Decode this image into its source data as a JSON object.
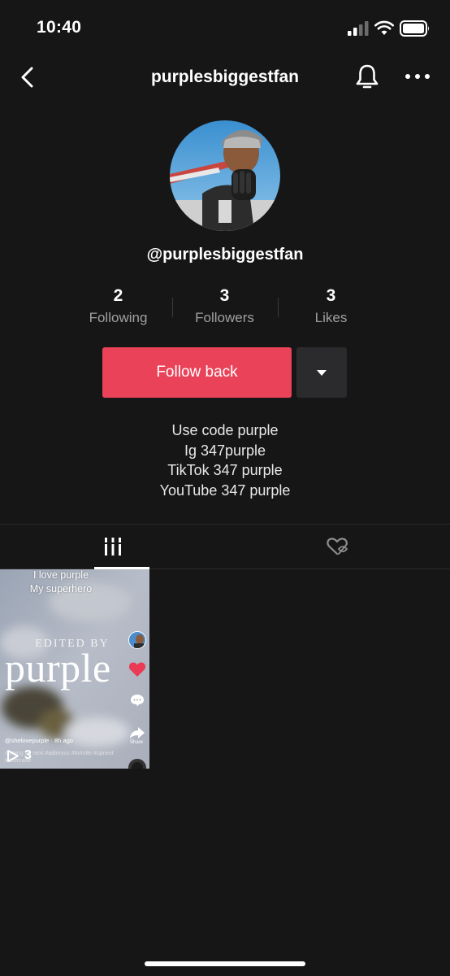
{
  "status_bar": {
    "time": "10:40"
  },
  "nav": {
    "title": "purplesbiggestfan"
  },
  "profile": {
    "handle": "@purplesbiggestfan",
    "stats": [
      {
        "value": "2",
        "label": "Following"
      },
      {
        "value": "3",
        "label": "Followers"
      },
      {
        "value": "3",
        "label": "Likes"
      }
    ],
    "follow_label": "Follow back",
    "bio": [
      "Use code purple",
      "Ig 347purple",
      "TikTok 347 purple",
      "YouTube 347 purple"
    ]
  },
  "tabs": [
    {
      "icon": "grid-icon",
      "active": true
    },
    {
      "icon": "liked-private-icon",
      "active": false
    }
  ],
  "videos": [
    {
      "caption_line1": "I love purple",
      "caption_line2": "My superhero",
      "edited_by": "EDITED BY",
      "brand": "purple",
      "username": "@shelovepurple · 8h ago",
      "description": "coming up next #adinross #fortnite #upnext #selfmade",
      "share_label": "Share",
      "play_count": "3"
    }
  ],
  "colors": {
    "accent": "#ea4359",
    "background": "#161616",
    "secondary_text": "#a0a0a3"
  }
}
